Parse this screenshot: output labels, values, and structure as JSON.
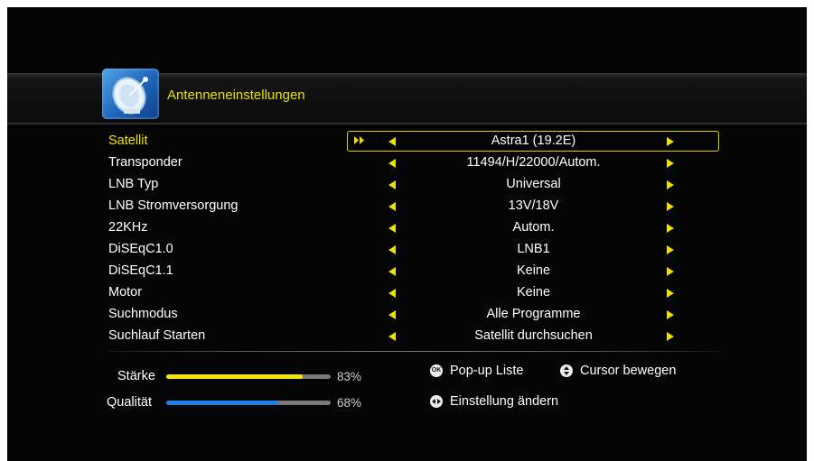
{
  "header": {
    "title": "Antenneneinstellungen"
  },
  "settings": [
    {
      "label": "Satellit",
      "value": "Astra1 (19.2E)"
    },
    {
      "label": "Transponder",
      "value": "11494/H/22000/Autom."
    },
    {
      "label": "LNB Typ",
      "value": "Universal"
    },
    {
      "label": "LNB Stromversorgung",
      "value": "13V/18V"
    },
    {
      "label": "22KHz",
      "value": "Autom."
    },
    {
      "label": "DiSEqC1.0",
      "value": "LNB1"
    },
    {
      "label": "DiSEqC1.1",
      "value": "Keine"
    },
    {
      "label": "Motor",
      "value": "Keine"
    },
    {
      "label": "Suchmodus",
      "value": "Alle Programme"
    },
    {
      "label": "Suchlauf Starten",
      "value": "Satellit durchsuchen"
    }
  ],
  "signal": {
    "strength": {
      "label": "Stärke",
      "value": "83%",
      "fraction": 0.83,
      "color": "#f2e500"
    },
    "quality": {
      "label": "Qualität",
      "value": "68%",
      "fraction": 0.68,
      "color": "#1e7fe8"
    }
  },
  "hints": {
    "ok": {
      "icon": "OK",
      "text": "Pop-up Liste"
    },
    "cursor": {
      "text": "Cursor bewegen"
    },
    "change": {
      "text": "Einstellung ändern"
    }
  },
  "colors": {
    "accent": "#f0e000",
    "background": "#050505"
  }
}
